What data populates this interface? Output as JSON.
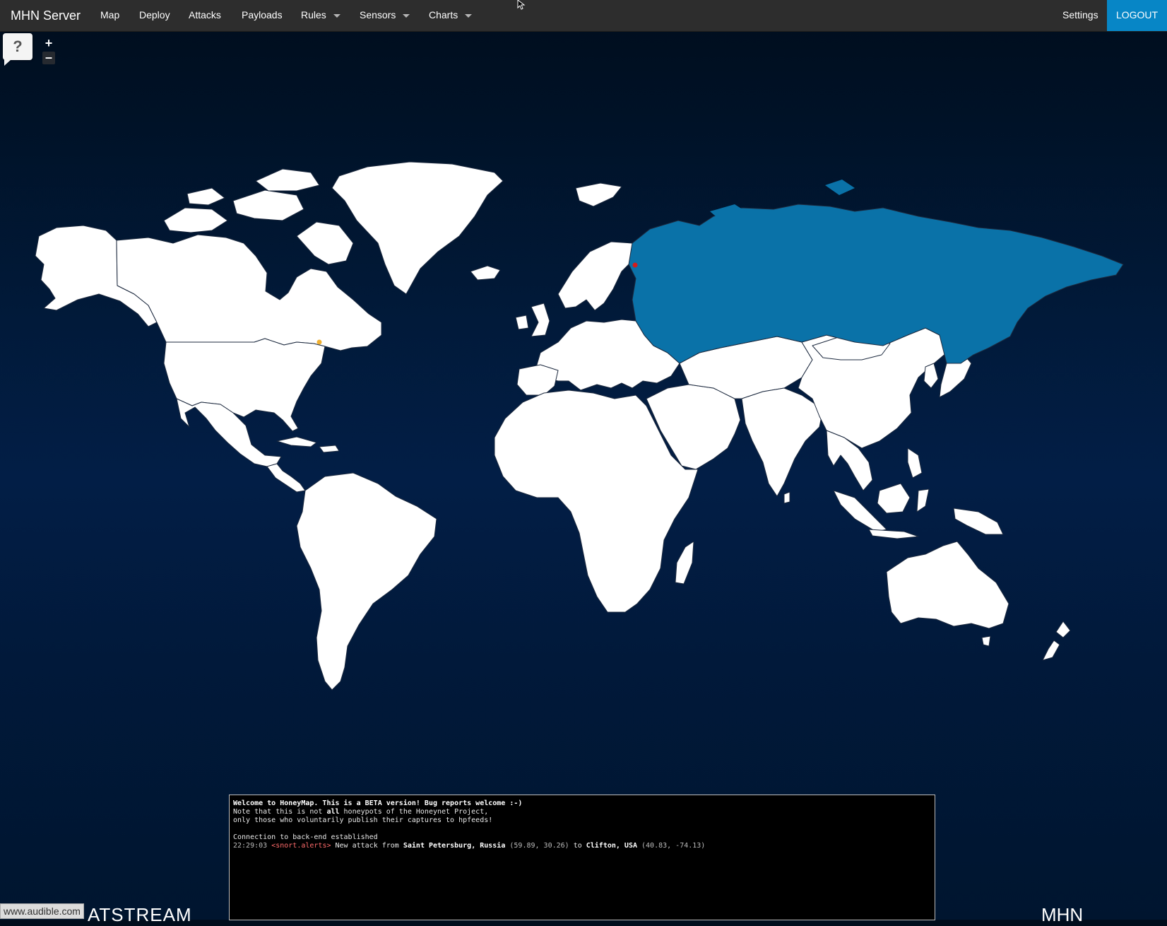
{
  "navbar": {
    "brand": "MHN Server",
    "items": [
      {
        "label": "Map"
      },
      {
        "label": "Deploy"
      },
      {
        "label": "Attacks"
      },
      {
        "label": "Payloads"
      },
      {
        "label": "Rules",
        "dropdown": true
      },
      {
        "label": "Sensors",
        "dropdown": true
      },
      {
        "label": "Charts",
        "dropdown": true
      }
    ],
    "settings": "Settings",
    "logout": "LOGOUT"
  },
  "map_controls": {
    "help": "?",
    "zoom_in": "+",
    "zoom_out": "–"
  },
  "map": {
    "highlighted_country": "Russia",
    "colors": {
      "land": "#ffffff",
      "highlight": "#0a72a8",
      "border": "#1d2a3f",
      "attack_source": "#d21d1d",
      "attack_target": "#f0b030"
    },
    "markers": [
      {
        "role": "source",
        "name": "Saint Petersburg, Russia"
      },
      {
        "role": "target",
        "name": "Clifton, USA"
      }
    ]
  },
  "console": {
    "line1": "Welcome to HoneyMap. This is a BETA version! Bug reports welcome :-)",
    "line2a": "Note that this is not ",
    "line2b": "all",
    "line2c": " honeypots of the Honeynet Project,",
    "line3": "only those who voluntarily publish their captures to hpfeeds!",
    "line4": "Connection to back-end established",
    "log": {
      "time": "22:29:03",
      "channel": "<snort.alerts>",
      "text1": " New attack from ",
      "src": "Saint Petersburg, Russia",
      "src_coords": " (59.89, 30.26) ",
      "text2": "to ",
      "dst": "Clifton, USA",
      "dst_coords": " (40.83, -74.13)"
    }
  },
  "footer": {
    "status_url": "www.audible.com",
    "threatstream": "ATSTREAM",
    "mhn": "MHN"
  }
}
